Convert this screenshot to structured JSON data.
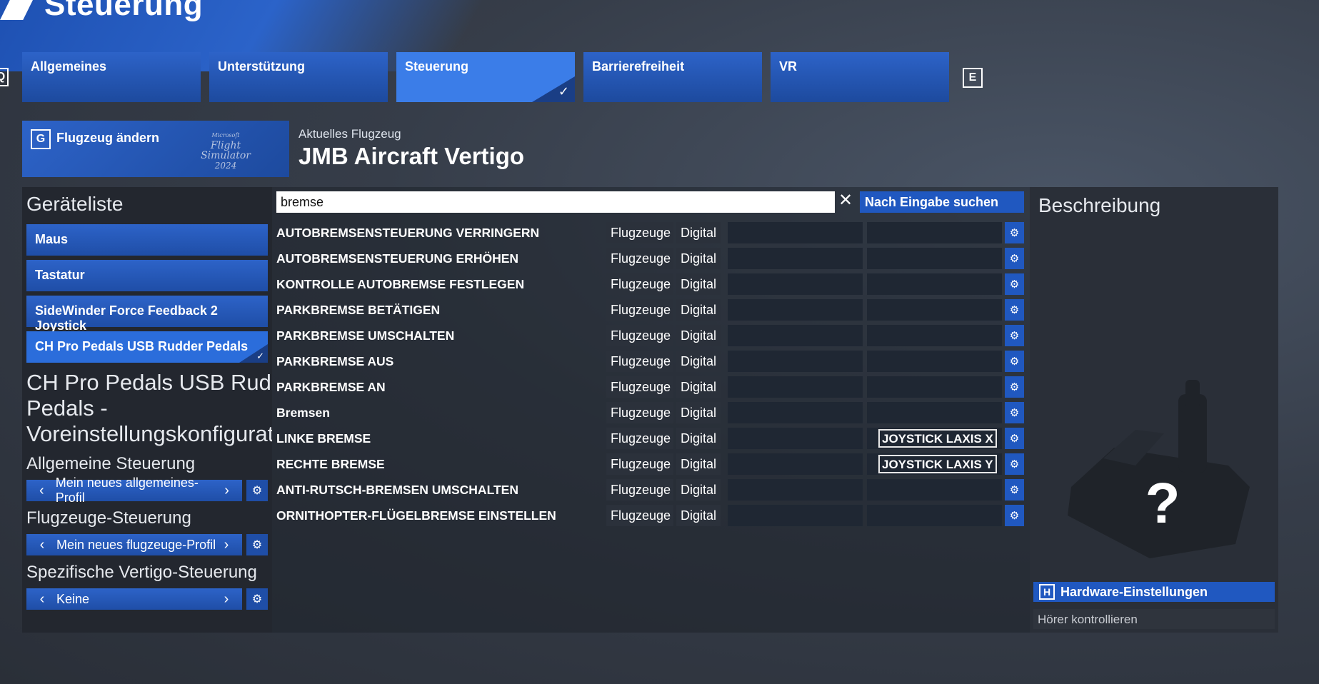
{
  "header": {
    "title": "Steuerung"
  },
  "tabs": [
    {
      "label": "Allgemeines",
      "active": false
    },
    {
      "label": "Unterstützung",
      "active": false
    },
    {
      "label": "Steuerung",
      "active": true
    },
    {
      "label": "Barrierefreiheit",
      "active": false
    },
    {
      "label": "VR",
      "active": false
    }
  ],
  "tab_keys": {
    "left": "Q",
    "right": "E"
  },
  "aircraft": {
    "change_key": "G",
    "change_label": "Flugzeug ändern",
    "logo_lines": [
      "Microsoft",
      "Flight",
      "Simulator",
      "2024"
    ],
    "current_label": "Aktuelles Flugzeug",
    "current_name": "JMB Aircraft Vertigo"
  },
  "device_list": {
    "title": "Geräteliste",
    "items": [
      {
        "label": "Maus",
        "active": false
      },
      {
        "label": "Tastatur",
        "active": false
      },
      {
        "label": "SideWinder Force Feedback 2 Joystick",
        "active": false
      },
      {
        "label": "CH Pro Pedals USB Rudder Pedals",
        "active": true
      }
    ],
    "profile_title_lines": [
      "CH Pro Pedals USB Rudder",
      "Pedals -",
      "Voreinstellungskonfiguration"
    ],
    "general_label": "Allgemeine Steuerung",
    "general_value": "Mein neues allgemeines-Profil",
    "aircraft_label": "Flugzeuge-Steuerung",
    "aircraft_value": "Mein neues flugzeuge-Profil",
    "specific_label": "Spezifische Vertigo-Steuerung",
    "specific_value": "Keine"
  },
  "search": {
    "value": "bremse",
    "button_label": "Nach Eingabe suchen"
  },
  "bindings": [
    {
      "name": "AUTOBREMSENSTEUERUNG VERRINGERN",
      "category": "Flugzeuge",
      "mode": "Digital",
      "slot1": "",
      "slot2": ""
    },
    {
      "name": "AUTOBREMSENSTEUERUNG ERHÖHEN",
      "category": "Flugzeuge",
      "mode": "Digital",
      "slot1": "",
      "slot2": ""
    },
    {
      "name": "KONTROLLE AUTOBREMSE FESTLEGEN",
      "category": "Flugzeuge",
      "mode": "Digital",
      "slot1": "",
      "slot2": ""
    },
    {
      "name": "PARKBREMSE BETÄTIGEN",
      "category": "Flugzeuge",
      "mode": "Digital",
      "slot1": "",
      "slot2": ""
    },
    {
      "name": "PARKBREMSE UMSCHALTEN",
      "category": "Flugzeuge",
      "mode": "Digital",
      "slot1": "",
      "slot2": ""
    },
    {
      "name": "PARKBREMSE AUS",
      "category": "Flugzeuge",
      "mode": "Digital",
      "slot1": "",
      "slot2": ""
    },
    {
      "name": "PARKBREMSE AN",
      "category": "Flugzeuge",
      "mode": "Digital",
      "slot1": "",
      "slot2": ""
    },
    {
      "name": "Bremsen",
      "category": "Flugzeuge",
      "mode": "Digital",
      "slot1": "",
      "slot2": ""
    },
    {
      "name": "LINKE BREMSE",
      "category": "Flugzeuge",
      "mode": "Digital",
      "slot1": "",
      "slot2": "JOYSTICK LAXIS X"
    },
    {
      "name": "RECHTE BREMSE",
      "category": "Flugzeuge",
      "mode": "Digital",
      "slot1": "",
      "slot2": "JOYSTICK LAXIS Y"
    },
    {
      "name": "ANTI-RUTSCH-BREMSEN UMSCHALTEN",
      "category": "Flugzeuge",
      "mode": "Digital",
      "slot1": "",
      "slot2": ""
    },
    {
      "name": "ORNITHOPTER-FLÜGELBREMSE EINSTELLEN",
      "category": "Flugzeuge",
      "mode": "Digital",
      "slot1": "",
      "slot2": ""
    }
  ],
  "description": {
    "title": "Beschreibung",
    "unknown_glyph": "?",
    "hardware_key": "H",
    "hardware_label": "Hardware-Einstellungen",
    "listen_label": "Hörer kontrollieren"
  },
  "colors": {
    "accent": "#2058c0",
    "tab": "#2d63c8",
    "active_tab": "#3b7de8",
    "panel": "#23272f"
  }
}
